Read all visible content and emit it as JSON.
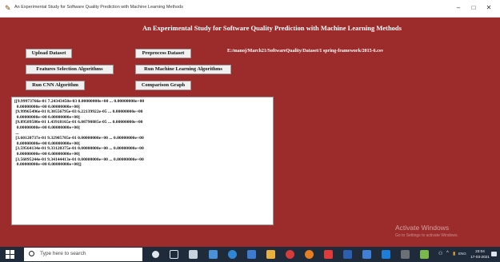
{
  "window": {
    "title": "An Experimental Study for Software Quality Prediction with Machine Learning Methods",
    "minimize": "–",
    "maximize": "□",
    "close": "✕"
  },
  "app": {
    "heading": "An Experimental Study for Software Quality Prediction with Machine Learning Methods",
    "buttons": {
      "upload": "Upload Dataset",
      "preprocess": "Preprocess Dataset",
      "features": "Features Selection Algorithms",
      "run_ml": "Run Machine Learning Algorithms",
      "run_cnn": "Run CNN Algorithm",
      "comparison": "Comparison Graph"
    },
    "dataset_path": "E:/manoj/March21/SoftwareQuality/Dataset/1 spring-framework/2015-6.csv",
    "output_lines": [
      "[[9.99973766e-01 7.24343450e-03 0.00000000e+00 ... 0.00000000e+00",
      "  0.00000000e+00 0.00000000e+00]",
      " [9.99965496e-01 8.30556795e-03 6.22139922e-05 ... 0.00000000e+00",
      "  0.00000000e+00 0.00000000e+00]",
      " [9.89589580e-01 1.43918165e-01 6.08790885e-05 ... 0.00000000e+00",
      "  0.00000000e+00 0.00000000e+00]",
      " ...",
      " [3.60120737e-01 9.32905705e-01 0.00000000e+00 ... 0.00000000e+00",
      "  0.00000000e+00 0.00000000e+00]",
      " [3.59564134e-01 9.33120375e-01 0.00000000e+00 ... 0.00000000e+00",
      "  0.00000000e+00 0.00000000e+00]",
      " [3.56895244e-01 9.34144413e-01 0.00000000e+00 ... 0.00000000e+00",
      "  0.00000000e+00 0.00000000e+00]]"
    ]
  },
  "watermark": {
    "title": "Activate Windows",
    "subtitle": "Go to Settings to activate Windows."
  },
  "taskbar": {
    "search_placeholder": "Type here to search",
    "tray_text": "ENG",
    "time": "23:04",
    "date": "17-03-2021"
  },
  "colors": {
    "app_background": "#9c2b2b",
    "taskbar": "#1f2b3a",
    "button_face": "#f0f0f0"
  }
}
